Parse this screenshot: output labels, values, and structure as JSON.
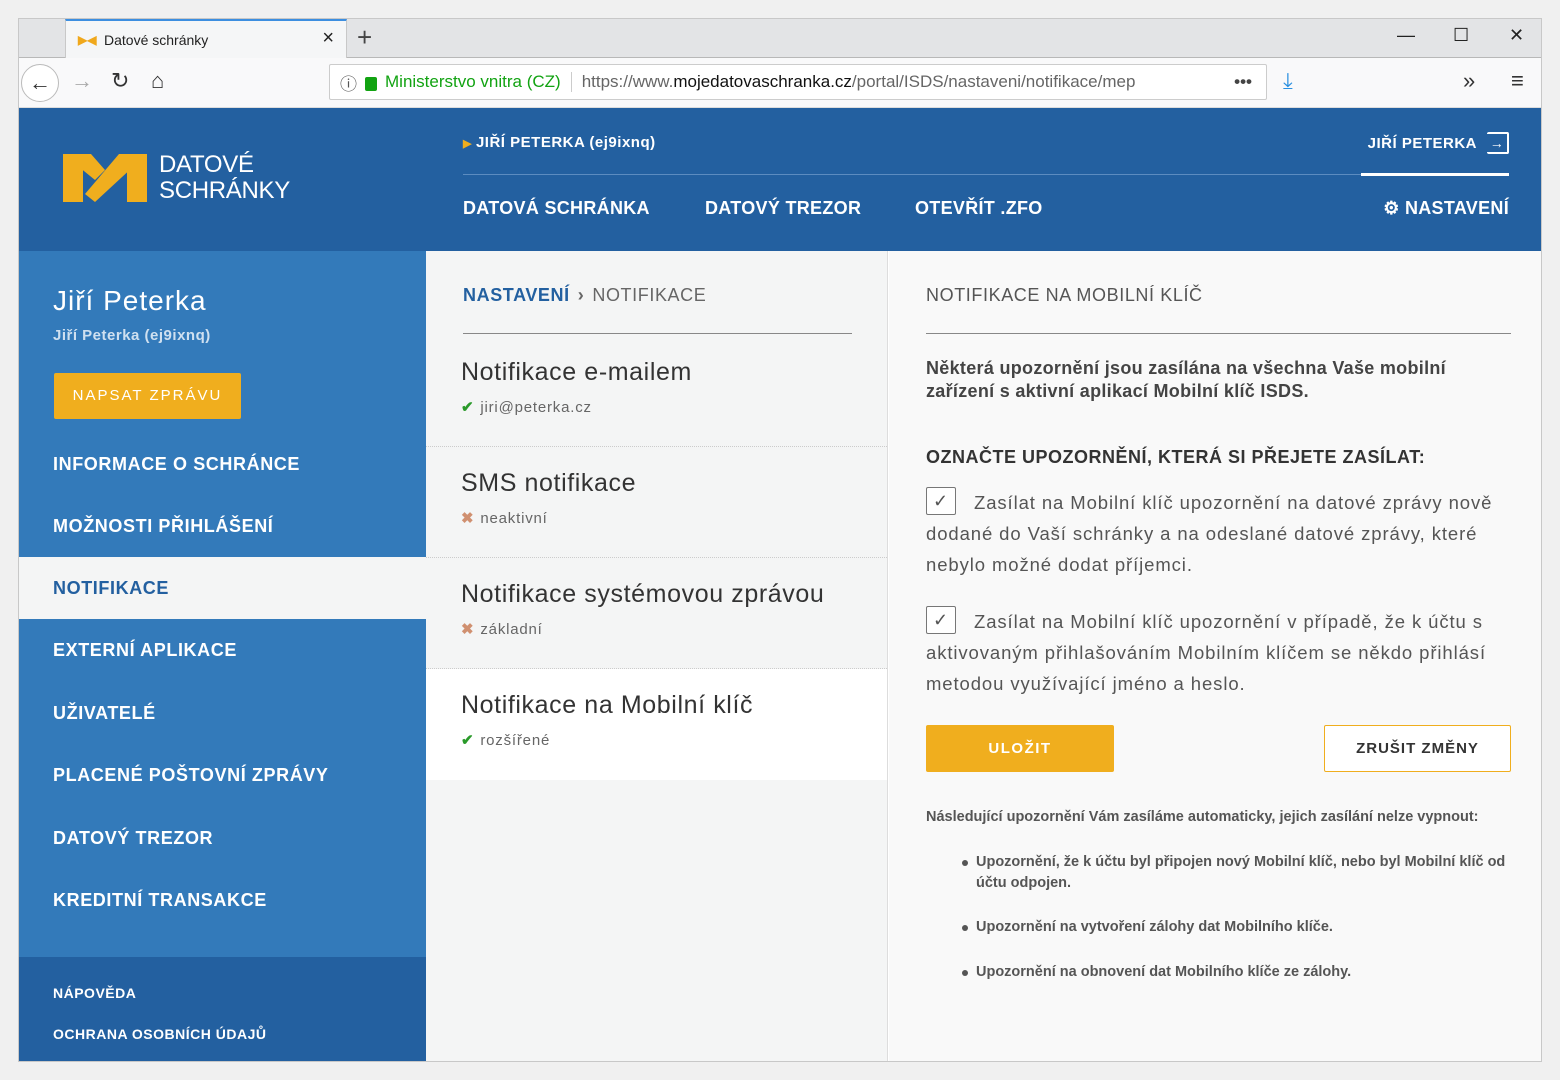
{
  "browser": {
    "tab_title": "Datové schránky",
    "url_org": "Ministerstvo vnitra (CZ)",
    "url_prefix": "https://www.",
    "url_domain": "mojedatovaschranka.cz",
    "url_path": "/portal/ISDS/nastaveni/notifikace/mep"
  },
  "header": {
    "logo_line1": "DATOVÉ",
    "logo_line2": "SCHRÁNKY",
    "user_box": "JIŘÍ PETERKA (ej9ixnq)",
    "user_name": "JIŘÍ PETERKA",
    "nav": [
      "DATOVÁ SCHRÁNKA",
      "DATOVÝ TREZOR",
      "OTEVŘÍT .ZFO"
    ],
    "settings": "NASTAVENÍ"
  },
  "sidebar": {
    "name": "Jiří Peterka",
    "id": "Jiří Peterka (ej9ixnq)",
    "write_button": "NAPSAT ZPRÁVU",
    "items": [
      "INFORMACE O SCHRÁNCE",
      "MOŽNOSTI PŘIHLÁŠENÍ",
      "NOTIFIKACE",
      "EXTERNÍ APLIKACE",
      "UŽIVATELÉ",
      "PLACENÉ POŠTOVNÍ ZPRÁVY",
      "DATOVÝ TREZOR",
      "KREDITNÍ TRANSAKCE"
    ],
    "active_item": "NOTIFIKACE",
    "footer": [
      "NÁPOVĚDA",
      "OCHRANA OSOBNÍCH ÚDAJŮ"
    ]
  },
  "breadcrumb": {
    "parent": "NASTAVENÍ",
    "current": "NOTIFIKACE"
  },
  "notifications": [
    {
      "title": "Notifikace e-mailem",
      "status": "jiri@peterka.cz",
      "state": "ok"
    },
    {
      "title": "SMS notifikace",
      "status": "neaktivní",
      "state": "off"
    },
    {
      "title": "Notifikace systémovou zprávou",
      "status": "základní",
      "state": "off"
    },
    {
      "title": "Notifikace na Mobilní klíč",
      "status": "rozšířené",
      "state": "ok"
    }
  ],
  "detail": {
    "title": "NOTIFIKACE NA MOBILNÍ KLÍČ",
    "intro": "Některá upozornění jsou zasílána na všechna Vaše mobilní zařízení s aktivní aplikací Mobilní klíč ISDS.",
    "heading": "OZNAČTE UPOZORNĚNÍ, KTERÁ SI PŘEJETE ZASÍLAT:",
    "options": [
      {
        "label": "Zasílat na Mobilní klíč upozornění na datové zprávy nově dodané do Vaší schránky a na odeslané datové zprávy, které nebylo možné dodat příjemci.",
        "checked": true
      },
      {
        "label": "Zasílat na Mobilní klíč upozornění v případě, že k účtu s aktivovaným přihlašováním Mobilním klíčem se někdo přihlásí metodou využívající jméno a heslo.",
        "checked": true
      }
    ],
    "save": "ULOŽIT",
    "cancel": "ZRUŠIT ZMĚNY",
    "auto_note": "Následující upozornění Vám zasíláme automaticky, jejich zasílání nelze vypnout:",
    "auto_items": [
      "Upozornění, že k účtu byl připojen nový Mobilní klíč, nebo byl Mobilní klíč od účtu odpojen.",
      "Upozornění na vytvoření zálohy dat Mobilního klíče.",
      "Upozornění na obnovení dat Mobilního klíče ze zálohy."
    ]
  },
  "colors": {
    "header": "#2360a0",
    "sidebar": "#337aba",
    "accent": "#f0ae1e"
  }
}
